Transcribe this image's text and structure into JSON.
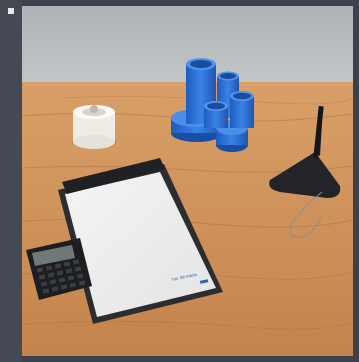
{
  "scene": {
    "subject": "office-desk-accessories",
    "colors": {
      "wall": "#b9bcbe",
      "desk": "#c98a52",
      "organizer": "#2f6fd0",
      "clipboard": "#2d2f33",
      "paper": "#eeeeee",
      "holder": "#f3f1ec",
      "calculator": "#1e2023",
      "pen-stand": "#23252a"
    }
  },
  "clipboard": {
    "paper_text": "Tim. Bll Kaleta"
  }
}
